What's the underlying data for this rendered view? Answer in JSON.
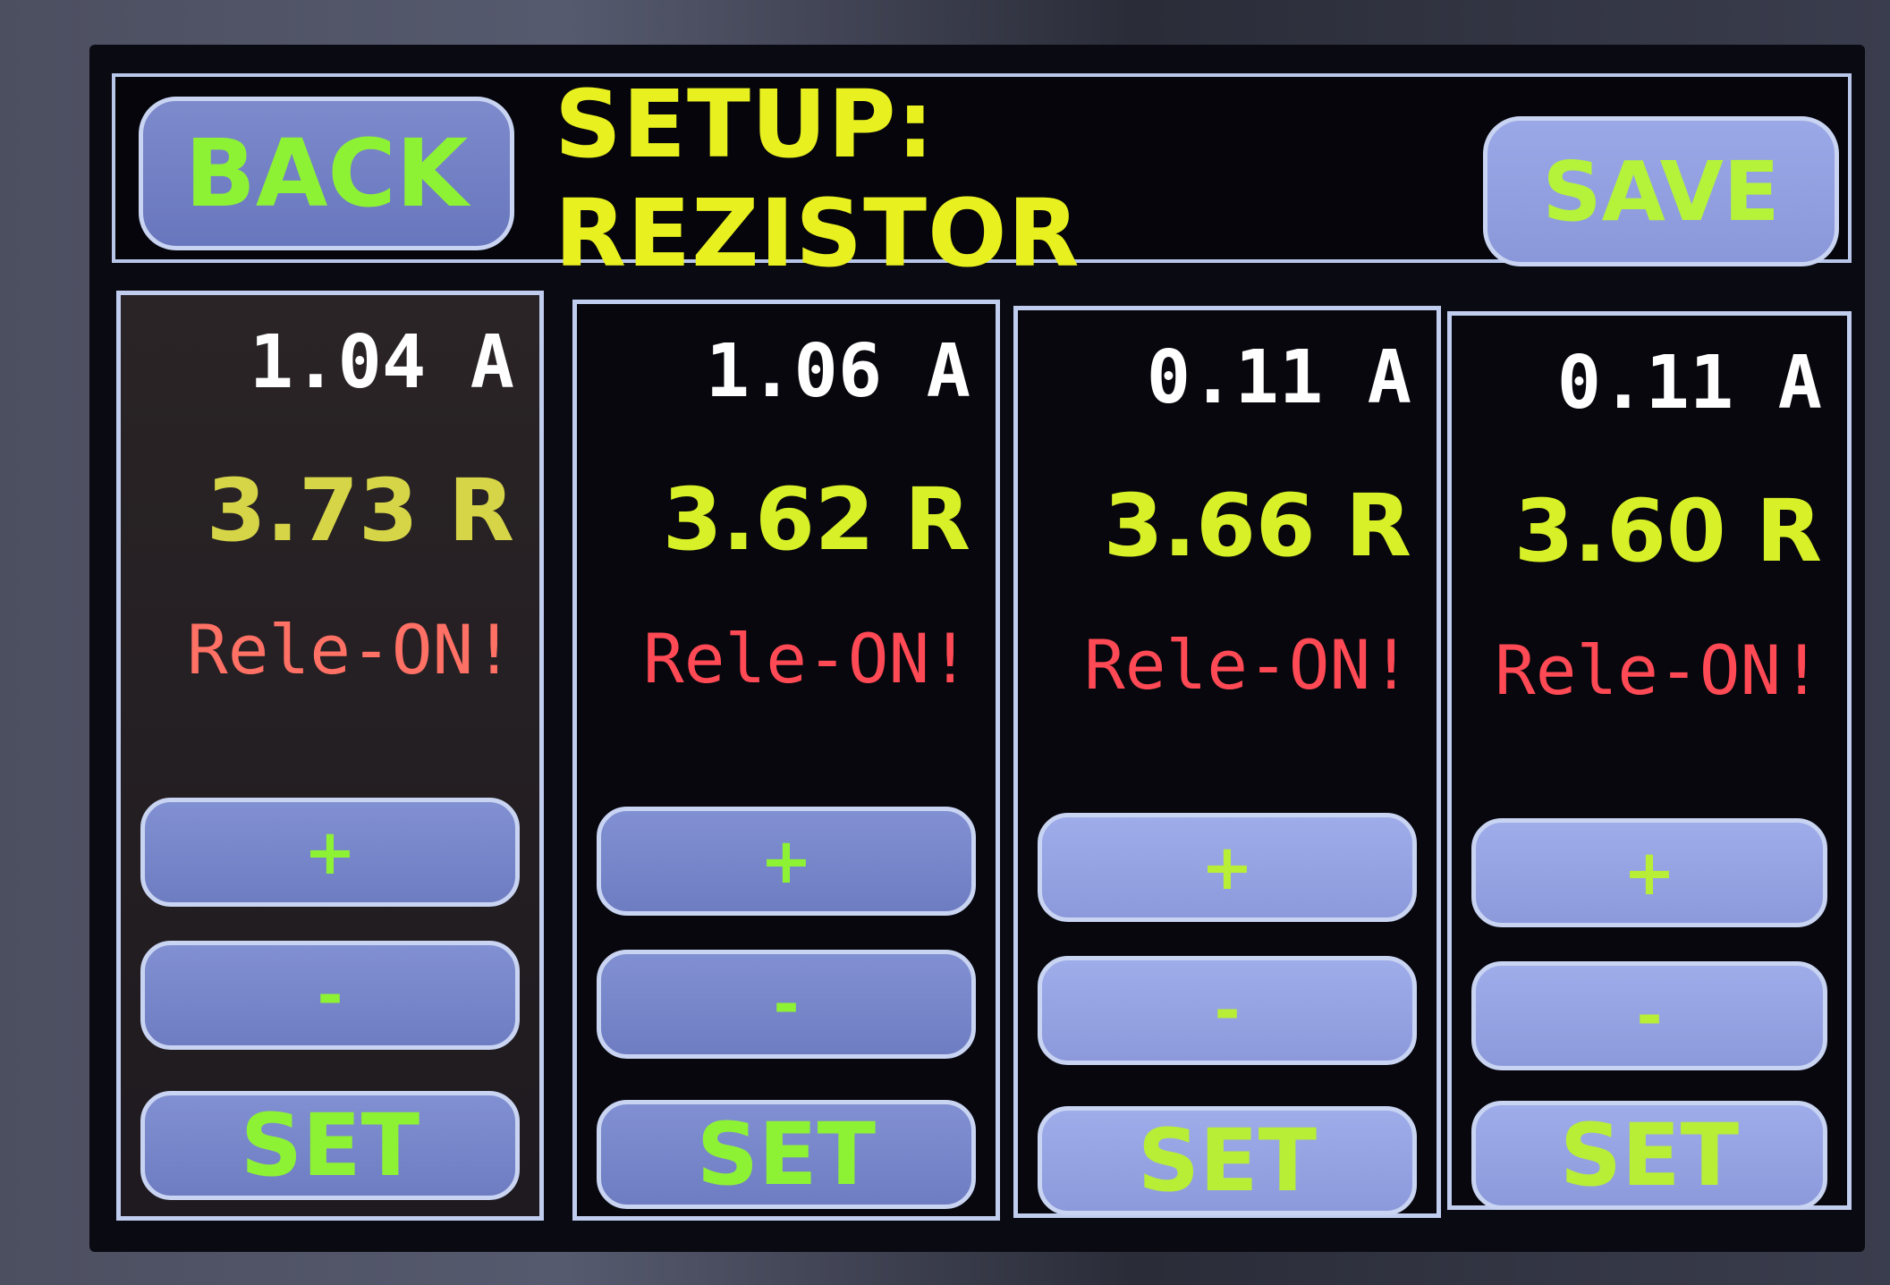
{
  "header": {
    "back_label": "BACK",
    "title": "SETUP: REZISTOR",
    "save_label": "SAVE"
  },
  "channels": [
    {
      "current": "1.04 A",
      "resistance": "3.73 R",
      "relay_status": "Rele-ON!",
      "plus_label": "+",
      "minus_label": "-",
      "set_label": "SET"
    },
    {
      "current": "1.06 A",
      "resistance": "3.62 R",
      "relay_status": "Rele-ON!",
      "plus_label": "+",
      "minus_label": "-",
      "set_label": "SET"
    },
    {
      "current": "0.11 A",
      "resistance": "3.66 R",
      "relay_status": "Rele-ON!",
      "plus_label": "+",
      "minus_label": "-",
      "set_label": "SET"
    },
    {
      "current": "0.11 A",
      "resistance": "3.60 R",
      "relay_status": "Rele-ON!",
      "plus_label": "+",
      "minus_label": "-",
      "set_label": "SET"
    }
  ],
  "colors": {
    "button_text": "#8ef234",
    "title_text": "#e8f020",
    "relay_text": "#ff4a55",
    "current_text": "#ffffff",
    "button_fill": "#7d8acc",
    "border": "#c0cdef"
  }
}
